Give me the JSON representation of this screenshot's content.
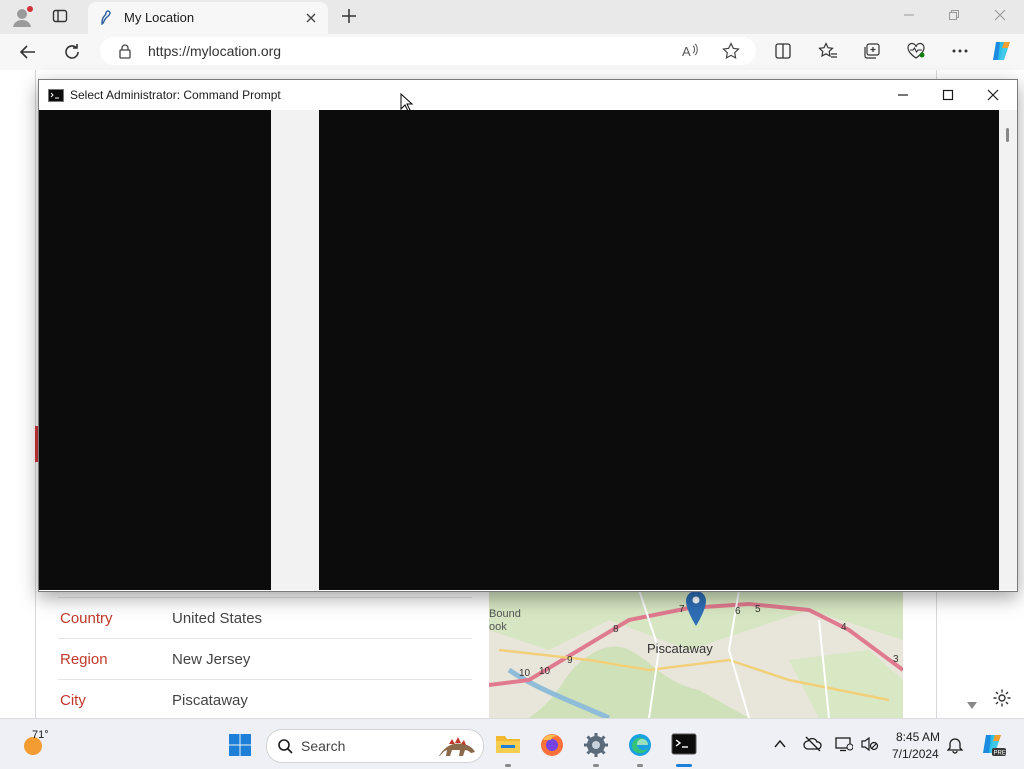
{
  "browser": {
    "tab_title": "My Location",
    "url": "https://mylocation.org"
  },
  "page": {
    "rows": [
      {
        "key": "Country",
        "value": "United States"
      },
      {
        "key": "Region",
        "value": "New Jersey"
      },
      {
        "key": "City",
        "value": "Piscataway"
      }
    ],
    "map": {
      "labels": {
        "main": "Piscataway",
        "edge1": "Bound",
        "edge2": "ook"
      },
      "route_numbers": [
        "10",
        "10",
        "9",
        "8",
        "7",
        "6",
        "5",
        "4",
        "3"
      ]
    }
  },
  "cmd_window": {
    "title": "Select Administrator: Command Prompt"
  },
  "taskbar": {
    "weather_temp": "71°",
    "search_placeholder": "Search",
    "time": "8:45 AM",
    "date": "7/1/2024"
  },
  "colors": {
    "accent_red": "#c0392b",
    "cmd_bg": "#0c0c0c",
    "map_pin": "#2f6db5"
  }
}
